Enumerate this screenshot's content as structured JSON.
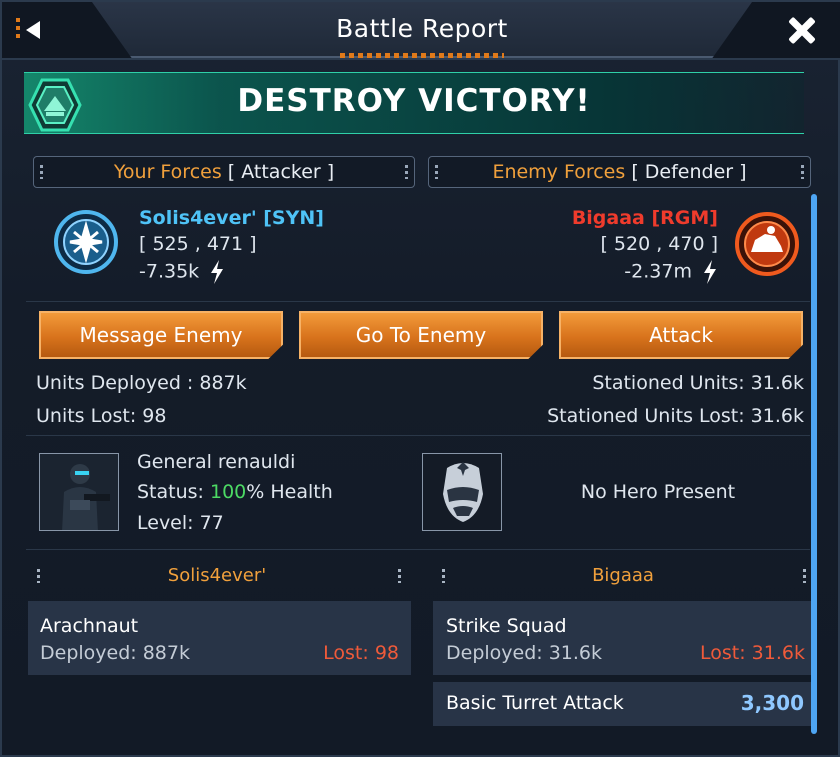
{
  "header": {
    "title": "Battle Report"
  },
  "banner": {
    "title": "DESTROY VICTORY!"
  },
  "attacker": {
    "label": "Your Forces",
    "role": "[ Attacker ]",
    "name": "Solis4ever' [SYN]",
    "coords": "[ 525 , 471 ]",
    "power": "-7.35k",
    "name_color": "#4fc3f7"
  },
  "defender": {
    "label": "Enemy Forces",
    "role": "[ Defender ]",
    "name": "Bigaaa [RGM]",
    "coords": "[ 520 , 470 ]",
    "power": "-2.37m",
    "name_color": "#ef3b2c"
  },
  "actions": {
    "message": "Message Enemy",
    "goto": "Go To Enemy",
    "attack": "Attack"
  },
  "stats": {
    "deployed": "Units Deployed : 887k",
    "lost": "Units Lost: 98",
    "stationed": "Stationed Units: 31.6k",
    "stationed_lost": "Stationed Units Lost: 31.6k"
  },
  "hero": {
    "name": "General renauldi",
    "status_label": "Status: ",
    "health_value": "100",
    "health_suffix": "% Health",
    "level": "Level: 77",
    "enemy_none": "No Hero Present"
  },
  "units": {
    "attacker_name": "Solis4ever'",
    "defender_name": "Bigaaa",
    "attacker_list": [
      {
        "name": "Arachnaut",
        "deployed": "Deployed: 887k",
        "lost": "Lost: 98"
      }
    ],
    "defender_list": [
      {
        "name": "Strike Squad",
        "deployed": "Deployed: 31.6k",
        "lost": "Lost: 31.6k"
      }
    ],
    "turret": {
      "label": "Basic Turret Attack",
      "value": "3,300"
    }
  },
  "colors": {
    "accent_orange": "#f0a03c",
    "victory_teal": "#1a9e82",
    "health_green": "#4cd964",
    "lost_red": "#ef5a3a",
    "turret_blue": "#8fc8ff"
  },
  "icons": {
    "back": "back-arrow-icon",
    "close": "close-icon",
    "victory": "victory-emblem-icon",
    "attacker": "attacker-alliance-emblem-icon",
    "defender": "defender-alliance-emblem-icon",
    "power": "lightning-bolt-icon",
    "enemy_hero": "masked-soldier-icon"
  }
}
